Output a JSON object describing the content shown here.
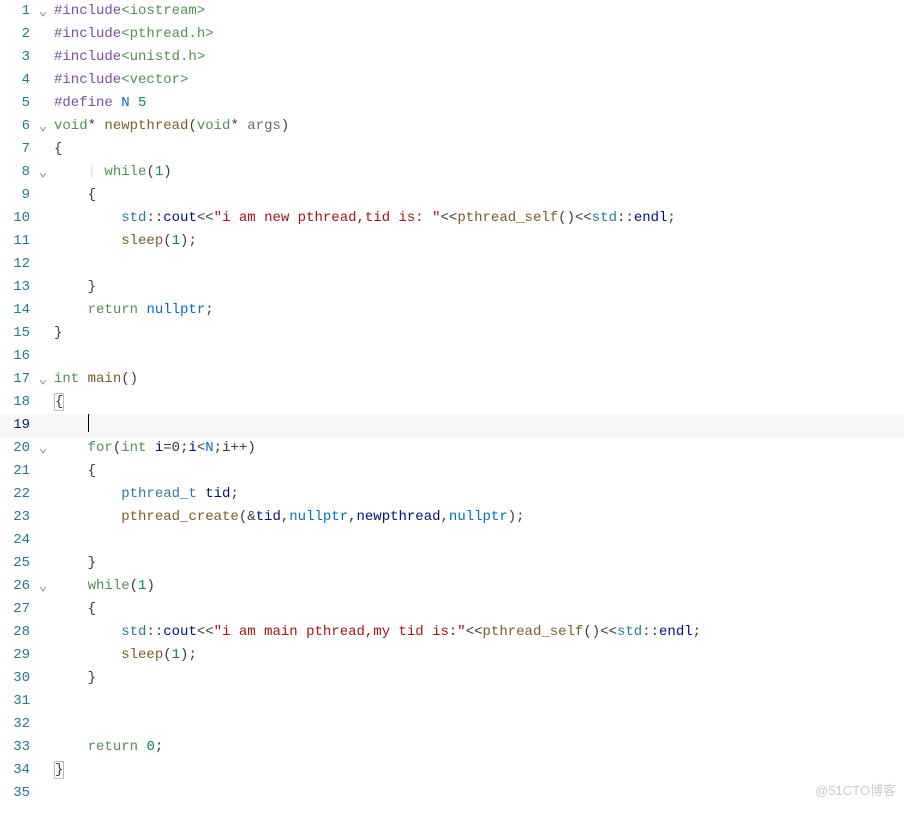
{
  "watermark": "@51CTO博客",
  "chev": "⌄",
  "tokens": {
    "hash_include": "#include",
    "hash_define": "#define",
    "hdr_iostream": "<iostream>",
    "hdr_pthread": "<pthread.h>",
    "hdr_unistd": "<unistd.h>",
    "hdr_vector": "<vector>",
    "N": "N",
    "five": "5",
    "void": "void",
    "star": "*",
    "newpthread": "newpthread",
    "lp": "(",
    "rp": ")",
    "args": "args",
    "lbrace": "{",
    "rbrace": "}",
    "while": "while",
    "one": "1",
    "std": "std",
    "cc": "::",
    "cout": "cout",
    "lt2": "<<",
    "s1": "\"i am new pthread,tid is: \"",
    "pthread_self": "pthread_self",
    "endl": "endl",
    "semi": ";",
    "sleep": "sleep",
    "return": "return",
    "nullptr": "nullptr",
    "int": "int",
    "main": "main",
    "for": "for",
    "i": "i",
    "eq0": "=0",
    "lt": "<",
    "ipp": ";i++",
    "pthread_t": "pthread_t",
    "tid": "tid",
    "pthread_create": "pthread_create",
    "amp": "&",
    "comma": ",",
    "s2": "\"i am main pthread,my tid is:\"",
    "zero": "0"
  },
  "lines": {
    "l1": "1",
    "l2": "2",
    "l3": "3",
    "l4": "4",
    "l5": "5",
    "l6": "6",
    "l7": "7",
    "l8": "8",
    "l9": "9",
    "l10": "10",
    "l11": "11",
    "l12": "12",
    "l13": "13",
    "l14": "14",
    "l15": "15",
    "l16": "16",
    "l17": "17",
    "l18": "18",
    "l19": "19",
    "l20": "20",
    "l21": "21",
    "l22": "22",
    "l23": "23",
    "l24": "24",
    "l25": "25",
    "l26": "26",
    "l27": "27",
    "l28": "28",
    "l29": "29",
    "l30": "30",
    "l31": "31",
    "l32": "32",
    "l33": "33",
    "l34": "34",
    "l35": "35"
  }
}
